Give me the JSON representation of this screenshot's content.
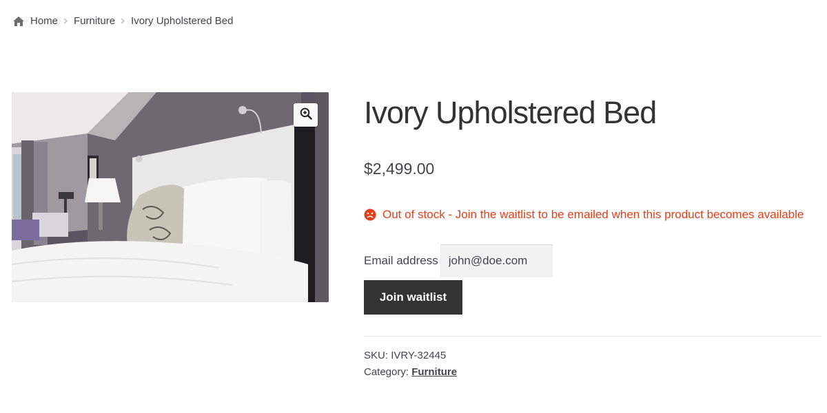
{
  "breadcrumb": {
    "home": "Home",
    "category": "Furniture",
    "current": "Ivory Upholstered Bed"
  },
  "product": {
    "title": "Ivory Upholstered Bed",
    "price": "$2,499.00",
    "stock_message": "Out of stock - Join the waitlist to be emailed when this product becomes available",
    "email_label": "Email address",
    "email_value": "john@doe.com",
    "join_button": "Join waitlist",
    "sku_label": "SKU:",
    "sku_value": "IVRY-32445",
    "category_label": "Category:",
    "category_value": "Furniture"
  },
  "icons": {
    "home": "home-icon",
    "separator": "chevron-right-icon",
    "zoom": "zoom-in-icon",
    "stock": "sad-face-icon"
  },
  "colors": {
    "error": "#e2401c",
    "button_bg": "#333333",
    "text": "#43454b"
  }
}
